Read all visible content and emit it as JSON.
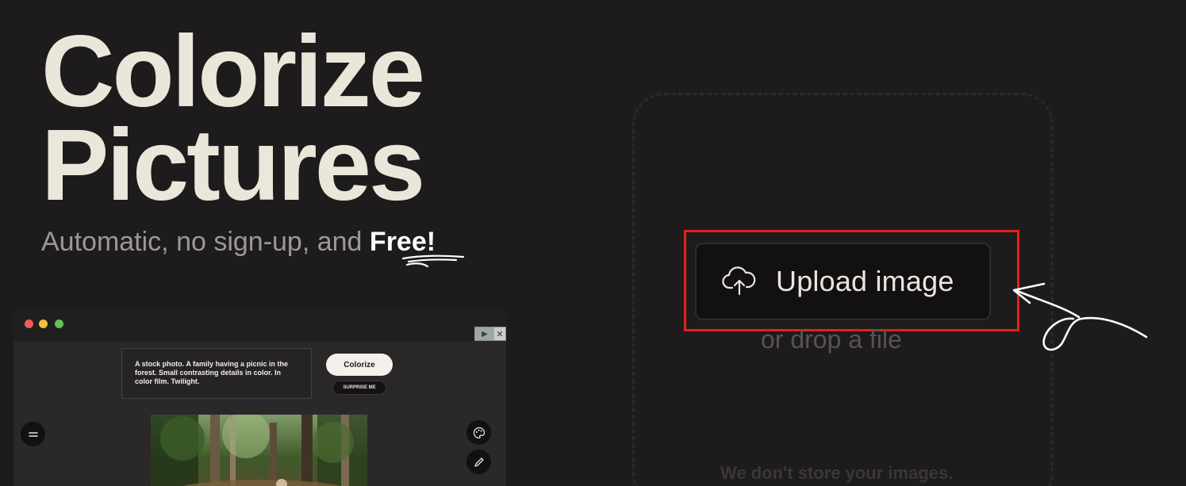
{
  "hero": {
    "title_line1": "Colorize",
    "title_line2": "Pictures",
    "subtitle_prefix": "Automatic, no sign-up, and ",
    "subtitle_emphasis": "Free!"
  },
  "preview": {
    "prompt_text": "A stock photo. A family having a picnic in the forest. Small contrasting details in color. In color film. Twilight.",
    "colorize_label": "Colorize",
    "surprise_label": "SURPRISE ME",
    "ad_choices_close": "✕",
    "icons": [
      "menu-icon",
      "palette-icon",
      "pencil-icon",
      "play-icon"
    ],
    "window_dot_colors": [
      "#ee5f57",
      "#f1c03d",
      "#5fc453"
    ]
  },
  "upload": {
    "button_label": "Upload image",
    "drop_text": "or drop a file",
    "privacy_text": "We don't store your images.",
    "icon": "cloud-upload-icon"
  },
  "colors": {
    "background": "#1d1b1c",
    "title": "#ebe6da",
    "highlight": "#e32219"
  }
}
